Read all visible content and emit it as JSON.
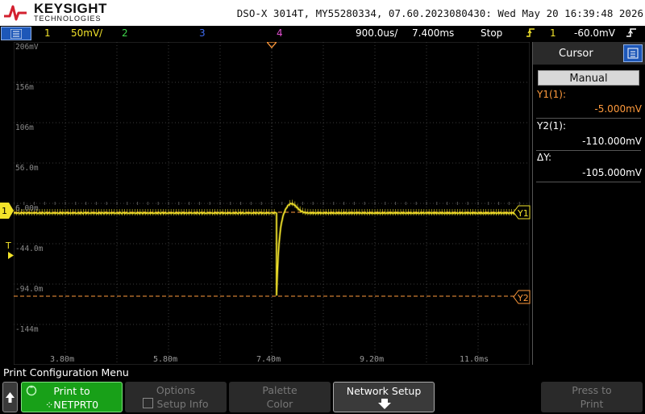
{
  "header": {
    "brand": "KEYSIGHT",
    "brand_sub": "TECHNOLOGIES",
    "instrument_info": "DSO-X 3014T, MY55280334, 07.60.2023080430: Wed May 20 16:39:48 2026"
  },
  "status_bar": {
    "ch1_num": "1",
    "ch1_scale": "50mV/",
    "ch2_num": "2",
    "ch3_num": "3",
    "ch4_num": "4",
    "timebase": "900.0us/",
    "delay": "7.400ms",
    "run_state": "Stop",
    "trig_src": "1",
    "trig_level": "-60.0mV"
  },
  "colors": {
    "ch1": "#f2e32a",
    "ch2": "#3fd84c",
    "ch3": "#3f6cf0",
    "ch4": "#e04fd0",
    "cursor": "#ff9a3c",
    "grid": "#3a3a3a"
  },
  "plot": {
    "y_labels": [
      "206mV",
      "156m",
      "106m",
      "56.0m",
      "6.00m",
      "-44.0m",
      "-94.0m",
      "-144m"
    ],
    "x_labels": [
      "3.80m",
      "5.80m",
      "7.40m",
      "9.20m",
      "11.0ms"
    ],
    "ch1_marker": "1",
    "trig_marker": "T",
    "y1_marker": "Y1",
    "y2_marker": "Y2"
  },
  "cursor_panel": {
    "title": "Cursor",
    "mode_button": "Manual",
    "y1_label": "Y1(1):",
    "y1_value": "-5.000mV",
    "y2_label": "Y2(1):",
    "y2_value": "-110.000mV",
    "dy_label": "ΔY:",
    "dy_value": "-105.000mV"
  },
  "softkeys": {
    "menu_title": "Print Configuration Menu",
    "print_to_label": "Print to",
    "print_to_value": "NETPRT0",
    "options_label": "Options",
    "options_value": "Setup Info",
    "palette_label": "Palette",
    "palette_value": "Color",
    "network_setup_label": "Network Setup",
    "press_to_label": "Press to",
    "press_to_value": "Print"
  }
}
